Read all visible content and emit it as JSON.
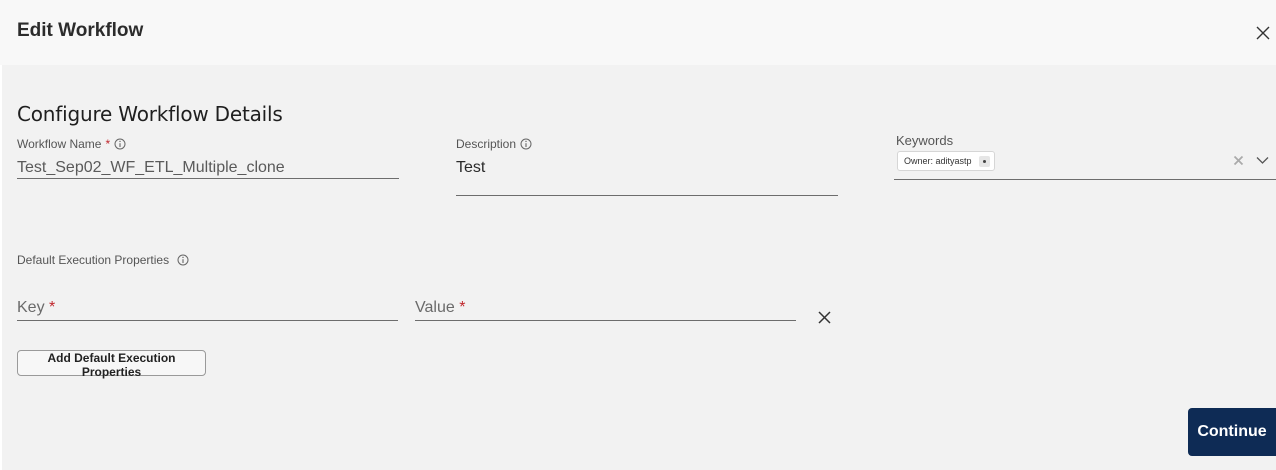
{
  "dialog": {
    "title": "Edit Workflow"
  },
  "section": {
    "title": "Configure Workflow Details"
  },
  "workflow_name": {
    "label": "Workflow Name",
    "required_mark": "*",
    "value": "Test_Sep02_WF_ETL_Multiple_clone"
  },
  "description": {
    "label": "Description",
    "value": "Test"
  },
  "keywords": {
    "label": "Keywords",
    "chips": [
      {
        "label": "Owner: adityastp"
      }
    ]
  },
  "execution_properties": {
    "label": "Default Execution Properties",
    "key_placeholder": "Key",
    "value_placeholder": "Value",
    "required_mark": "*",
    "add_button_label": "Add Default Execution Properties"
  },
  "footer": {
    "continue_label": "Continue"
  },
  "colors": {
    "primary_button": "#0e2b55",
    "required": "#c0262c",
    "background": "#f2f2f2",
    "header_background": "#f8f8f8"
  },
  "icons": {
    "close": "close-icon",
    "info": "info-icon",
    "clear": "clear-icon",
    "dropdown": "chevron-down-icon",
    "remove_row": "remove-row-icon"
  }
}
